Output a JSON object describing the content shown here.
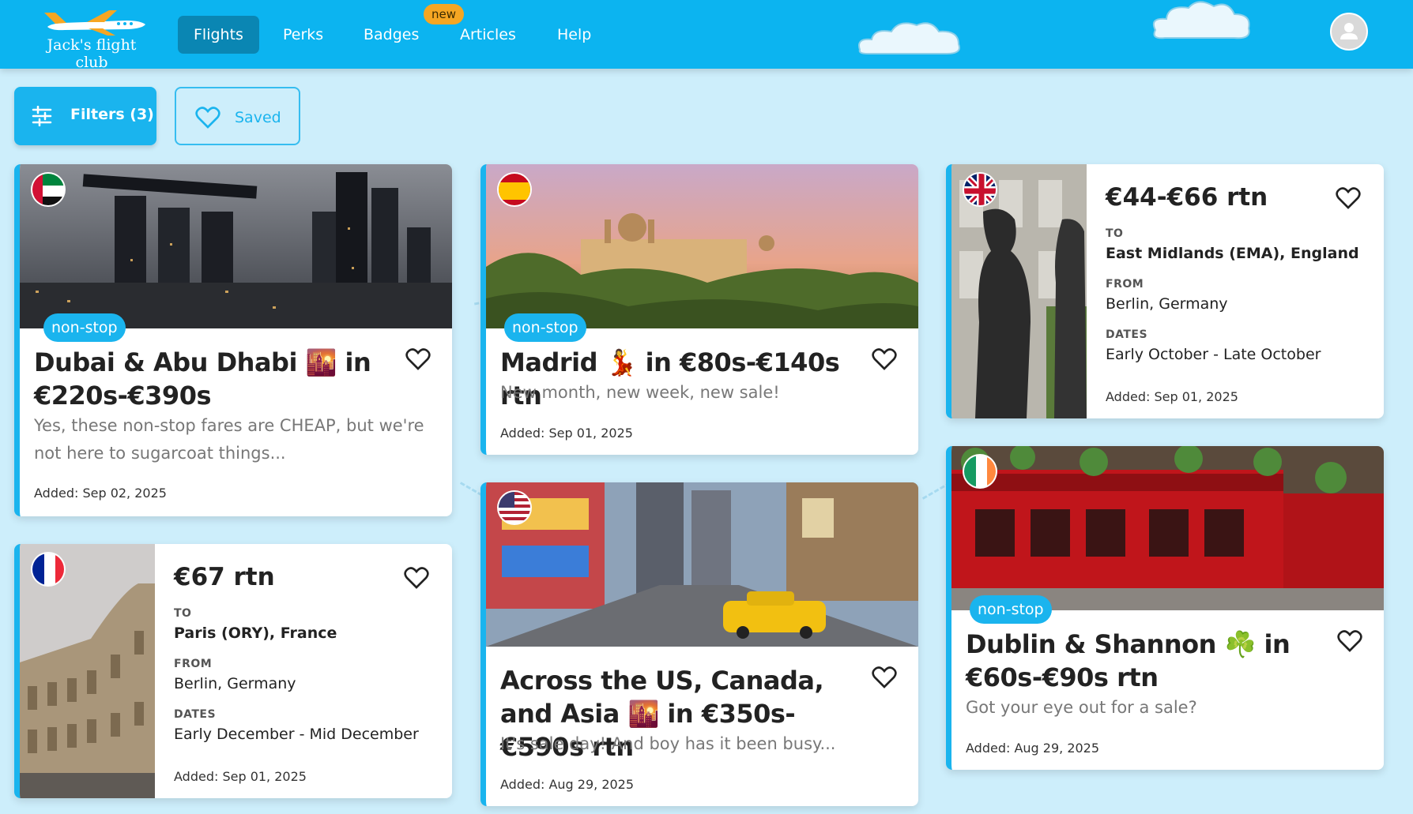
{
  "header": {
    "logo_text": "Jack's flight club",
    "nav": [
      {
        "label": "Flights",
        "active": true
      },
      {
        "label": "Perks",
        "active": false
      },
      {
        "label": "Badges",
        "active": false
      },
      {
        "label": "Articles",
        "active": false
      },
      {
        "label": "Help",
        "active": false
      }
    ],
    "new_badge": "new"
  },
  "toolbar": {
    "filters_label": "Filters (3)",
    "saved_label": "Saved"
  },
  "colors": {
    "accent": "#0cb4f0",
    "active_nav": "#0a86b3",
    "badge": "#f6a623",
    "page_bg": "#cdeefb"
  },
  "cards": [
    {
      "flag": "uae-flag-icon",
      "tag": "non-stop",
      "title": "Dubai & Abu Dhabi 🌇 in €220s-€390s",
      "subtitle": "Yes, these non-stop fares are CHEAP, but we're not here to sugarcoat things...",
      "added": "Added: Sep 02, 2025"
    },
    {
      "flag": "spain-flag-icon",
      "tag": "non-stop",
      "title": "Madrid 💃 in €80s-€140s rtn",
      "subtitle": "New month, new week, new sale!",
      "added": "Added: Sep 01, 2025"
    },
    {
      "flag": "uk-flag-icon",
      "price": "€44-€66 rtn",
      "to_label": "TO",
      "to": "East Midlands (EMA), England",
      "from_label": "FROM",
      "from": "Berlin, Germany",
      "dates_label": "DATES",
      "dates": "Early October - Late October",
      "added": "Added: Sep 01, 2025"
    },
    {
      "flag": "france-flag-icon",
      "price": "€67 rtn",
      "to_label": "TO",
      "to": "Paris (ORY), France",
      "from_label": "FROM",
      "from": "Berlin, Germany",
      "dates_label": "DATES",
      "dates": "Early December - Mid December",
      "added": "Added: Sep 01, 2025"
    },
    {
      "flag": "usa-flag-icon",
      "title": "Across the US, Canada, and Asia 🌇 in €350s-€590s rtn",
      "subtitle": "It's sale day! And boy has it been busy...",
      "added": "Added: Aug 29, 2025"
    },
    {
      "flag": "ireland-flag-icon",
      "tag": "non-stop",
      "title": "Dublin & Shannon ☘️ in €60s-€90s rtn",
      "subtitle": "Got your eye out for a sale?",
      "added": "Added: Aug 29, 2025"
    }
  ]
}
